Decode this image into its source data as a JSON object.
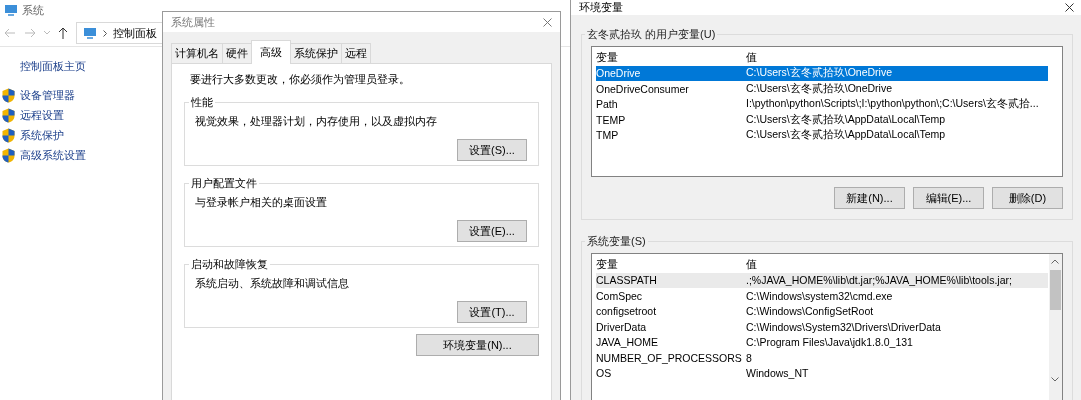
{
  "background_window": {
    "title": "系统",
    "breadcrumb": [
      "控制面板"
    ],
    "sidebar": {
      "home": "控制面板主页",
      "items": [
        "设备管理器",
        "远程设置",
        "系统保护",
        "高级系统设置"
      ]
    }
  },
  "system_properties": {
    "title": "系统属性",
    "tabs": [
      {
        "label": "计算机名",
        "selected": false
      },
      {
        "label": "硬件",
        "selected": false
      },
      {
        "label": "高级",
        "selected": true
      },
      {
        "label": "系统保护",
        "selected": false
      },
      {
        "label": "远程",
        "selected": false
      }
    ],
    "notice": "要进行大多数更改，你必须作为管理员登录。",
    "groups": [
      {
        "title": "性能",
        "description": "视觉效果，处理器计划，内存使用，以及虚拟内存",
        "button": "设置(S)..."
      },
      {
        "title": "用户配置文件",
        "description": "与登录帐户相关的桌面设置",
        "button": "设置(E)..."
      },
      {
        "title": "启动和故障恢复",
        "description": "系统启动、系统故障和调试信息",
        "button": "设置(T)..."
      }
    ],
    "env_button": "环境变量(N)..."
  },
  "environment_variables": {
    "title": "环境变量",
    "user_vars": {
      "title": "玄冬贰拾玖 的用户变量(U)",
      "columns": [
        "变量",
        "值"
      ],
      "rows": [
        {
          "name": "OneDrive",
          "value": "C:\\Users\\玄冬贰拾玖\\OneDrive",
          "selected": true,
          "highlighted": false
        },
        {
          "name": "OneDriveConsumer",
          "value": "C:\\Users\\玄冬贰拾玖\\OneDrive",
          "selected": false,
          "highlighted": false
        },
        {
          "name": "Path",
          "value": "I:\\python\\python\\Scripts\\;I:\\python\\python\\;C:\\Users\\玄冬贰拾...",
          "selected": false,
          "highlighted": false
        },
        {
          "name": "TEMP",
          "value": "C:\\Users\\玄冬贰拾玖\\AppData\\Local\\Temp",
          "selected": false,
          "highlighted": false
        },
        {
          "name": "TMP",
          "value": "C:\\Users\\玄冬贰拾玖\\AppData\\Local\\Temp",
          "selected": false,
          "highlighted": false
        }
      ],
      "buttons": [
        "新建(N)...",
        "编辑(E)...",
        "删除(D)"
      ]
    },
    "system_vars": {
      "title": "系统变量(S)",
      "columns": [
        "变量",
        "值"
      ],
      "rows": [
        {
          "name": "CLASSPATH",
          "value": ".;%JAVA_HOME%\\lib\\dt.jar;%JAVA_HOME%\\lib\\tools.jar;",
          "selected": false,
          "highlighted": true
        },
        {
          "name": "ComSpec",
          "value": "C:\\Windows\\system32\\cmd.exe",
          "selected": false,
          "highlighted": false
        },
        {
          "name": "configsetroot",
          "value": "C:\\Windows\\ConfigSetRoot",
          "selected": false,
          "highlighted": false
        },
        {
          "name": "DriverData",
          "value": "C:\\Windows\\System32\\Drivers\\DriverData",
          "selected": false,
          "highlighted": false
        },
        {
          "name": "JAVA_HOME",
          "value": "C:\\Program Files\\Java\\jdk1.8.0_131",
          "selected": false,
          "highlighted": false
        },
        {
          "name": "NUMBER_OF_PROCESSORS",
          "value": "8",
          "selected": false,
          "highlighted": false
        },
        {
          "name": "OS",
          "value": "Windows_NT",
          "selected": false,
          "highlighted": false
        }
      ]
    }
  }
}
